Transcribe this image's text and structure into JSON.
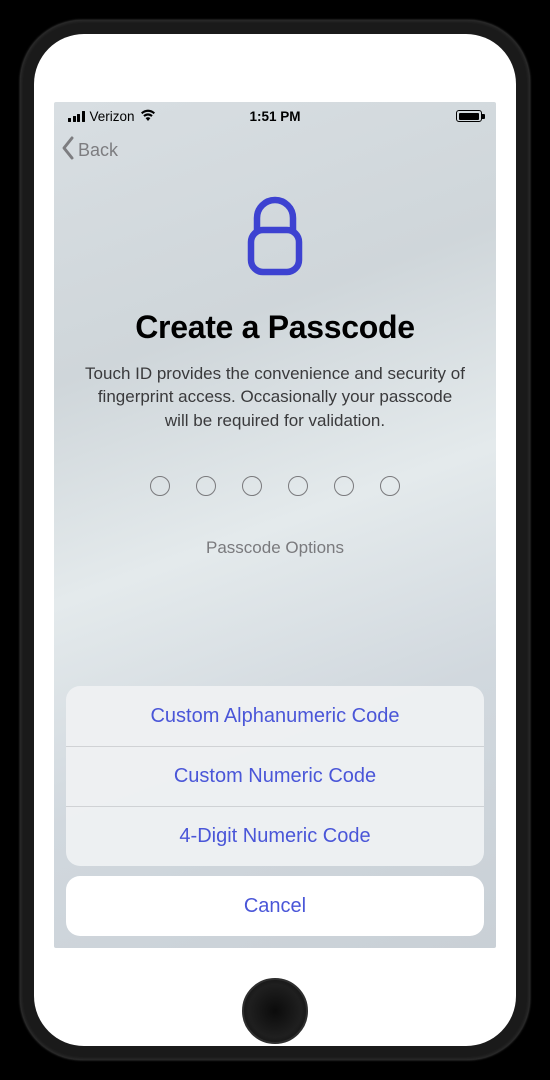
{
  "status_bar": {
    "carrier": "Verizon",
    "time": "1:51 PM"
  },
  "nav": {
    "back_label": "Back"
  },
  "main": {
    "title": "Create a Passcode",
    "subtitle": "Touch ID provides the convenience and security of fingerprint access. Occasionally your passcode will be required for validation.",
    "passcode_length": 6,
    "options_label": "Passcode Options"
  },
  "action_sheet": {
    "options": [
      {
        "label": "Custom Alphanumeric Code"
      },
      {
        "label": "Custom Numeric Code"
      },
      {
        "label": "4-Digit Numeric Code"
      }
    ],
    "cancel_label": "Cancel"
  },
  "colors": {
    "accent": "#4a56d8",
    "muted": "#7d7d80"
  }
}
